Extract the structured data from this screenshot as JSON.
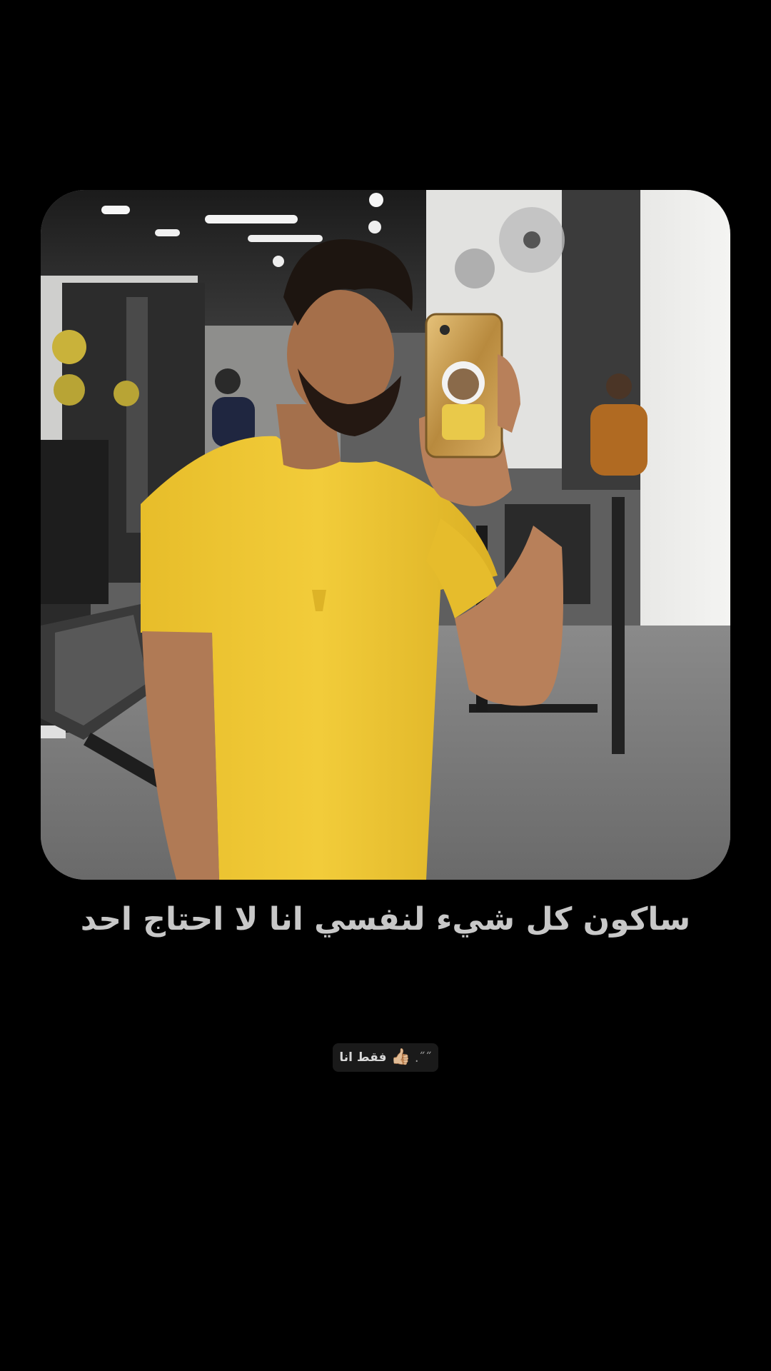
{
  "post": {
    "photo_alt": "mirror selfie in gym, yellow t-shirt",
    "caption": "ساكون كل شيء لنفسي انا لا احتاج احد",
    "sticker": {
      "text": "فقط انا",
      "emoji": "👍🏼",
      "trail": "˝˝."
    }
  },
  "colors": {
    "background": "#000000",
    "caption_text": "#c8c8c8",
    "sticker_bg": "#1a1a1a",
    "shirt_yellow": "#f0c832"
  }
}
